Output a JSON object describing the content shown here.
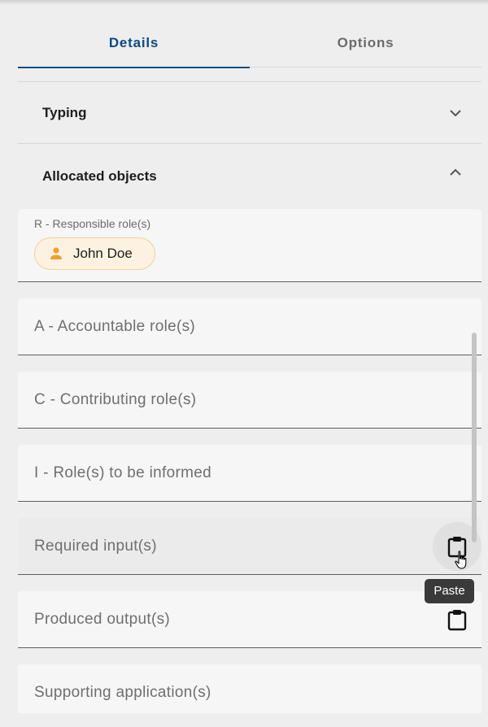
{
  "tabs": [
    {
      "label": "Details",
      "active": true
    },
    {
      "label": "Options",
      "active": false
    }
  ],
  "sections": {
    "typing": {
      "title": "Typing",
      "state": "collapsed"
    },
    "allocated": {
      "title": "Allocated objects",
      "state": "expanded"
    }
  },
  "responsible": {
    "label": "R - Responsible role(s)",
    "chip": {
      "name": "John Doe",
      "icon": "person-icon"
    }
  },
  "fields": [
    {
      "label": "A - Accountable role(s)"
    },
    {
      "label": "C - Contributing role(s)"
    },
    {
      "label": "I - Role(s) to be informed"
    },
    {
      "label": "Required input(s)",
      "action_icon": "clipboard-icon"
    },
    {
      "label": "Produced output(s)",
      "action_icon": "clipboard-icon"
    },
    {
      "label": "Supporting application(s)"
    }
  ],
  "tooltip": "Paste",
  "colors": {
    "accent": "#0d4a80",
    "chip_bg": "#fdf2e2",
    "chip_border": "#f3cf96",
    "chip_icon": "#f0a030",
    "tooltip_bg": "#3a3a3a"
  }
}
